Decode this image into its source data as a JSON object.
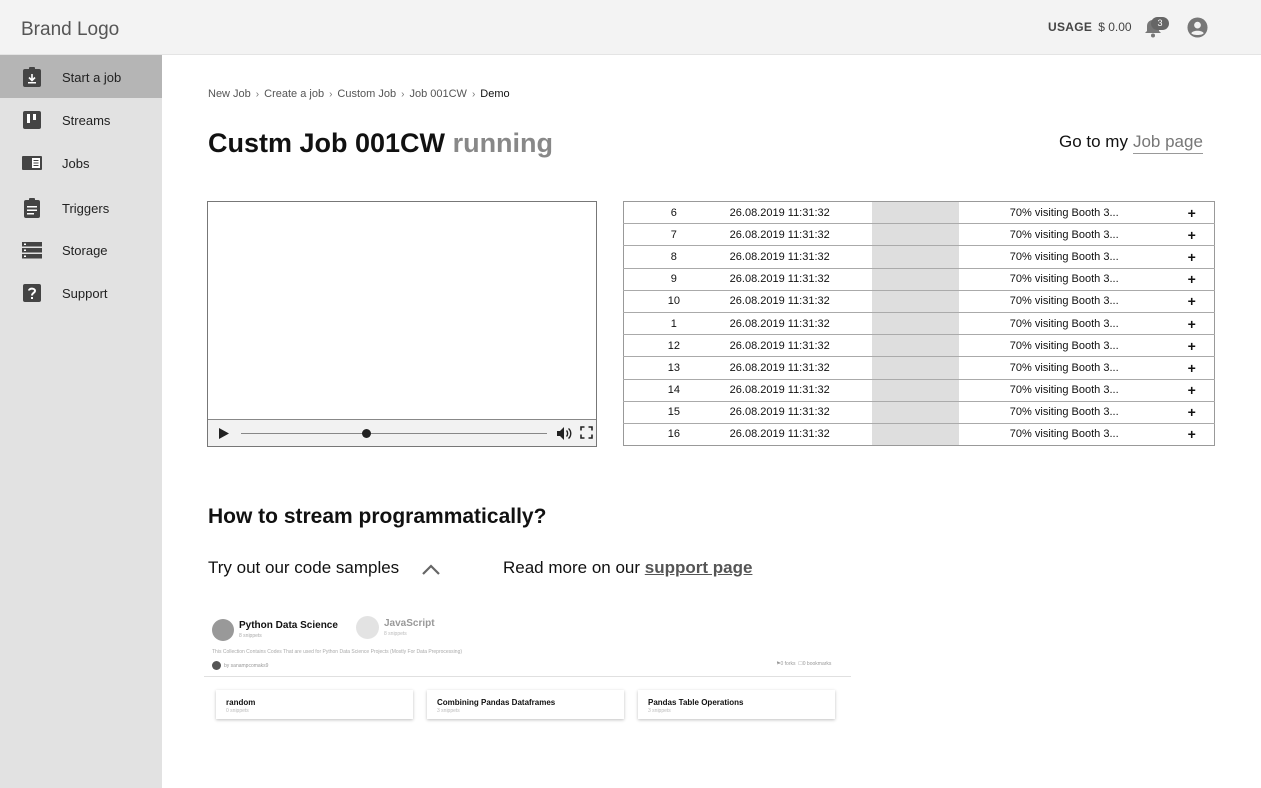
{
  "header": {
    "brand": "Brand Logo",
    "usage_label": "USAGE",
    "usage_value": "$ 0.00",
    "notifications_count": "3"
  },
  "sidebar": {
    "items": [
      {
        "label": "Start a job",
        "icon": "clipboard-download-icon",
        "active": true
      },
      {
        "label": "Streams",
        "icon": "streams-icon"
      },
      {
        "label": "Jobs",
        "icon": "jobs-icon"
      },
      {
        "label": "Triggers",
        "icon": "clipboard-icon"
      },
      {
        "label": "Storage",
        "icon": "storage-icon"
      },
      {
        "label": "Support",
        "icon": "help-icon"
      }
    ]
  },
  "breadcrumb": [
    "New Job",
    "Create a job",
    "Custom Job",
    "Job 001CW",
    "Demo"
  ],
  "page": {
    "title": "Custm Job 001CW",
    "status": "running",
    "job_link_prefix": "Go to my",
    "job_link_label": "Job page"
  },
  "video": {
    "progress": 0.41
  },
  "table": {
    "rows": [
      {
        "id": "6",
        "date": "26.08.2019 11:31:32",
        "desc": "70% visiting Booth 3...",
        "action": "+"
      },
      {
        "id": "7",
        "date": "26.08.2019 11:31:32",
        "desc": "70% visiting Booth 3...",
        "action": "+"
      },
      {
        "id": "8",
        "date": "26.08.2019 11:31:32",
        "desc": "70% visiting Booth 3...",
        "action": "+"
      },
      {
        "id": "9",
        "date": "26.08.2019 11:31:32",
        "desc": "70% visiting Booth 3...",
        "action": "+"
      },
      {
        "id": "10",
        "date": "26.08.2019 11:31:32",
        "desc": "70% visiting Booth 3...",
        "action": "+"
      },
      {
        "id": "1",
        "date": "26.08.2019 11:31:32",
        "desc": "70% visiting Booth 3...",
        "action": "+"
      },
      {
        "id": "12",
        "date": "26.08.2019 11:31:32",
        "desc": "70% visiting Booth 3...",
        "action": "+"
      },
      {
        "id": "13",
        "date": "26.08.2019 11:31:32",
        "desc": "70% visiting Booth 3...",
        "action": "+"
      },
      {
        "id": "14",
        "date": "26.08.2019 11:31:32",
        "desc": "70% visiting Booth 3...",
        "action": "+"
      },
      {
        "id": "15",
        "date": "26.08.2019 11:31:32",
        "desc": "70% visiting Booth 3...",
        "action": "+"
      },
      {
        "id": "16",
        "date": "26.08.2019 11:31:32",
        "desc": "70% visiting Booth 3...",
        "action": "+"
      }
    ]
  },
  "howto": {
    "heading": "How to stream programmatically?",
    "try_label": "Try out our code samples",
    "read_prefix": "Read more on our",
    "read_link": "support page"
  },
  "snippets": {
    "collection1_name": "Python Data Science",
    "collection1_count": "8 snippets",
    "collection2_name": "JavaScript",
    "collection2_count": "8 snippets",
    "description": "This Collection Contains Codes That are used for Python Data Science Projects (Mostly For Data Preprocessing)",
    "author": "by sanampcomaks9",
    "likes": "0 forks",
    "bookmarks": "0 bookmarks",
    "cards": [
      {
        "title": "random",
        "sub": "0 snippets"
      },
      {
        "title": "Combining Pandas Dataframes",
        "sub": "3 snippets"
      },
      {
        "title": "Pandas Table Operations",
        "sub": "3 snippets"
      }
    ]
  }
}
